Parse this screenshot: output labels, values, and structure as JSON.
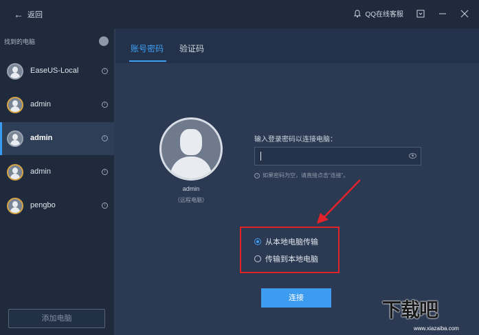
{
  "topbar": {
    "back_label": "返回",
    "support_label": "QQ在线客服"
  },
  "sidebar": {
    "title": "找到的电脑",
    "items": [
      {
        "label": "EaseUS-Local",
        "active": false
      },
      {
        "label": "admin",
        "active": false
      },
      {
        "label": "admin",
        "active": true
      },
      {
        "label": "admin",
        "active": false
      },
      {
        "label": "pengbo",
        "active": false
      }
    ],
    "add_label": "添加电脑"
  },
  "tabs": [
    {
      "label": "账号密码",
      "active": true
    },
    {
      "label": "验证码",
      "active": false
    }
  ],
  "remote": {
    "name": "admin",
    "subtitle": "（远程电脑）"
  },
  "login": {
    "prompt": "输入登录密码以连接电脑：",
    "password_value": "",
    "hint": "如果密码为空，请直接点击“连接”。"
  },
  "transfer_options": [
    {
      "label": "从本地电脑传输",
      "checked": true
    },
    {
      "label": "传输到本地电脑",
      "checked": false
    }
  ],
  "connect_label": "连接",
  "watermark": {
    "text": "下载吧",
    "url": "www.xiazaiba.com"
  },
  "colors": {
    "accent": "#3ea0f5",
    "annotation": "#e2232a",
    "sidebar_bg": "#1f2b3d",
    "main_bg": "#2b3a52"
  }
}
